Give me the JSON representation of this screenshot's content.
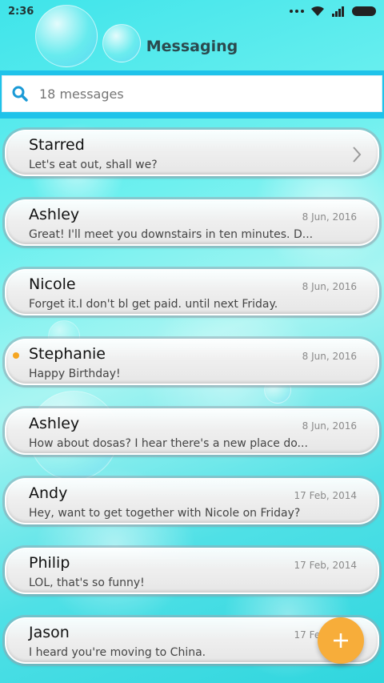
{
  "status_bar": {
    "time": "2:36",
    "icons": [
      "more-dots-icon",
      "wifi-icon",
      "signal-icon",
      "battery-icon"
    ]
  },
  "header": {
    "title": "Messaging"
  },
  "search": {
    "placeholder": "18 messages",
    "icon": "search-icon"
  },
  "conversations": [
    {
      "name": "Starred",
      "preview": "Let's eat out, shall we?",
      "date": "",
      "unread": false,
      "chevron": true
    },
    {
      "name": "Ashley",
      "preview": "Great! I'll meet you downstairs in ten minutes. D...",
      "date": "8 Jun, 2016",
      "unread": false,
      "chevron": false
    },
    {
      "name": "Nicole",
      "preview": "Forget it.I don't bl get paid. until next Friday.",
      "date": "8 Jun, 2016",
      "unread": false,
      "chevron": false
    },
    {
      "name": "Stephanie",
      "preview": "Happy Birthday!",
      "date": "8 Jun, 2016",
      "unread": true,
      "chevron": false
    },
    {
      "name": "Ashley",
      "preview": "How about dosas? I hear there's a new place do...",
      "date": "8 Jun, 2016",
      "unread": false,
      "chevron": false
    },
    {
      "name": "Andy",
      "preview": "Hey, want to get together with Nicole on Friday?",
      "date": "17 Feb, 2014",
      "unread": false,
      "chevron": false
    },
    {
      "name": "Philip",
      "preview": "LOL, that's so funny!",
      "date": "17 Feb, 2014",
      "unread": false,
      "chevron": false
    },
    {
      "name": "Jason",
      "preview": "I heard you're moving to China.",
      "date": "17 Feb, 2014",
      "unread": false,
      "chevron": false
    }
  ],
  "fab": {
    "icon": "plus-icon"
  },
  "colors": {
    "accent": "#1fc3ea",
    "unread_dot": "#f5a623",
    "fab": "#f7ad3a"
  }
}
